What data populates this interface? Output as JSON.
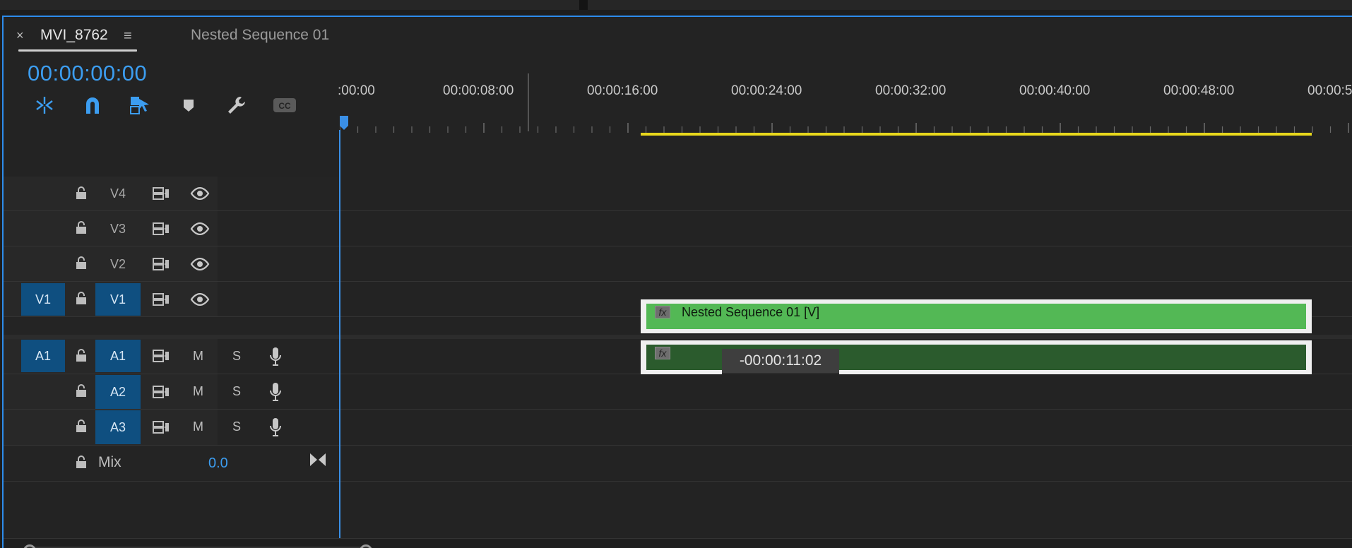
{
  "tabs": {
    "close_glyph": "×",
    "active": "MVI_8762",
    "menu_glyph": "≡",
    "inactive": "Nested Sequence 01"
  },
  "timecode": "00:00:00:00",
  "toolbar": {
    "icons": [
      "nest-toggle-icon",
      "snap-icon",
      "linked-selection-icon",
      "add-marker-icon",
      "settings-wrench-icon",
      "captions-icon"
    ]
  },
  "ruler": {
    "labels": [
      ":00:00",
      "00:00:08:00",
      "00:00:16:00",
      "00:00:24:00",
      "00:00:32:00",
      "00:00:40:00",
      "00:00:48:00",
      "00:00:5"
    ]
  },
  "tracks": {
    "video": [
      {
        "source": "",
        "target": "V4",
        "target_on": false
      },
      {
        "source": "",
        "target": "V3",
        "target_on": false
      },
      {
        "source": "",
        "target": "V2",
        "target_on": false
      },
      {
        "source": "V1",
        "target": "V1",
        "target_on": true
      }
    ],
    "audio": [
      {
        "source": "A1",
        "target": "A1",
        "target_on": true,
        "mute": "M",
        "solo": "S"
      },
      {
        "source": "",
        "target": "A2",
        "target_on": true,
        "mute": "M",
        "solo": "S"
      },
      {
        "source": "",
        "target": "A3",
        "target_on": true,
        "mute": "M",
        "solo": "S"
      }
    ],
    "mix": {
      "label": "Mix",
      "value": "0.0"
    }
  },
  "clips": {
    "video": {
      "name": "Nested Sequence 01 [V]",
      "fx": "fx"
    },
    "audio": {
      "fx": "fx"
    }
  },
  "tooltip": "-00:00:11:02",
  "colors": {
    "accent": "#2d8ceb",
    "timecode": "#3c9df0",
    "video_clip": "#53b855",
    "audio_clip": "#2b5b2d",
    "in_out_bar": "#e8d81c",
    "track_target": "#0f4f80"
  }
}
